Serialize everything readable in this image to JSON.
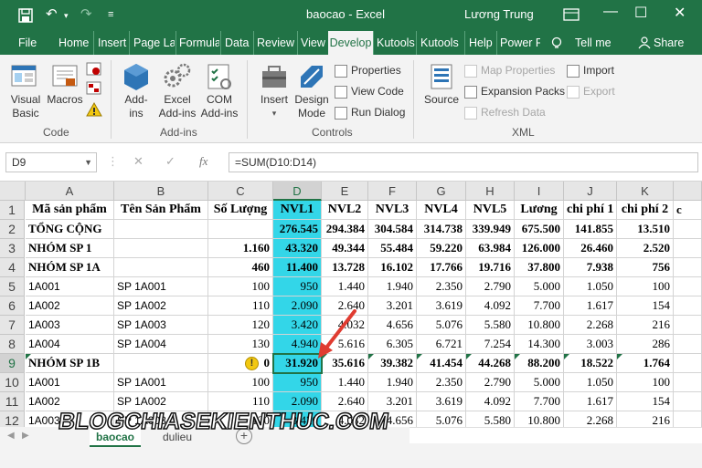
{
  "window": {
    "title": "baocao  -  Excel",
    "user": "Lương Trung",
    "minimize": "—",
    "restore": "☐",
    "close": "✕",
    "ribbon_display_icon": "ribbon-display-icon"
  },
  "quick_access": {
    "save_icon": "save-icon",
    "undo_icon": "undo-icon",
    "redo_icon": "redo-icon",
    "customize_icon": "customize-icon"
  },
  "tabs": [
    "File",
    "Home",
    "Insert",
    "Page La",
    "Formula",
    "Data",
    "Review",
    "View",
    "Develop",
    "Kutools",
    "Kutools",
    "Help",
    "Power P",
    "Tell me",
    "Share"
  ],
  "active_tab": "Develop",
  "ribbon": {
    "code": {
      "label": "Code",
      "visual_basic": [
        "Visual",
        "Basic"
      ],
      "macros": "Macros"
    },
    "addins": {
      "label": "Add-ins",
      "addins": [
        "Add-",
        "ins"
      ],
      "excel_addins": [
        "Excel",
        "Add-ins"
      ],
      "com_addins": [
        "COM",
        "Add-ins"
      ]
    },
    "controls": {
      "label": "Controls",
      "insert": "Insert",
      "design_mode": [
        "Design",
        "Mode"
      ],
      "properties": "Properties",
      "view_code": "View Code",
      "run_dialog": "Run Dialog"
    },
    "xml": {
      "label": "XML",
      "source": "Source",
      "map_properties": "Map Properties",
      "expansion_packs": "Expansion Packs",
      "refresh_data": "Refresh Data",
      "import": "Import",
      "export": "Export"
    }
  },
  "formula_bar": {
    "name_box": "D9",
    "cancel": "✕",
    "enter": "✓",
    "fx": "fx",
    "formula": "=SUM(D10:D14)"
  },
  "columns": [
    "A",
    "B",
    "C",
    "D",
    "E",
    "F",
    "G",
    "H",
    "I",
    "J",
    "K"
  ],
  "row_numbers": [
    "1",
    "2",
    "3",
    "4",
    "5",
    "6",
    "7",
    "8",
    "9",
    "10",
    "11",
    "12"
  ],
  "rows": [
    [
      "Mã sản phẩm",
      "Tên Sản Phẩm",
      "Số Lượng",
      "NVL1",
      "NVL2",
      "NVL3",
      "NVL4",
      "NVL5",
      "Lương",
      "chi phí 1",
      "chi phí 2"
    ],
    [
      "TỔNG CỘNG",
      "",
      "",
      "276.545",
      "294.384",
      "304.584",
      "314.738",
      "339.949",
      "675.500",
      "141.855",
      "13.510"
    ],
    [
      "NHÓM SP 1",
      "",
      "1.160",
      "43.320",
      "49.344",
      "55.484",
      "59.220",
      "63.984",
      "126.000",
      "26.460",
      "2.520"
    ],
    [
      "NHÓM SP 1A",
      "",
      "460",
      "11.400",
      "13.728",
      "16.102",
      "17.766",
      "19.716",
      "37.800",
      "7.938",
      "756"
    ],
    [
      "1A001",
      "SP 1A001",
      "100",
      "950",
      "1.440",
      "1.940",
      "2.350",
      "2.790",
      "5.000",
      "1.050",
      "100"
    ],
    [
      "1A002",
      "SP 1A002",
      "110",
      "2.090",
      "2.640",
      "3.201",
      "3.619",
      "4.092",
      "7.700",
      "1.617",
      "154"
    ],
    [
      "1A003",
      "SP 1A003",
      "120",
      "3.420",
      "4.032",
      "4.656",
      "5.076",
      "5.580",
      "10.800",
      "2.268",
      "216"
    ],
    [
      "1A004",
      "SP 1A004",
      "130",
      "4.940",
      "5.616",
      "6.305",
      "6.721",
      "7.254",
      "14.300",
      "3.003",
      "286"
    ],
    [
      "NHÓM SP 1B",
      "",
      "0",
      "31.920",
      "35.616",
      "39.382",
      "41.454",
      "44.268",
      "88.200",
      "18.522",
      "1.764"
    ],
    [
      "1A001",
      "SP 1A001",
      "100",
      "950",
      "1.440",
      "1.940",
      "2.350",
      "2.790",
      "5.000",
      "1.050",
      "100"
    ],
    [
      "1A002",
      "SP 1A002",
      "110",
      "2.090",
      "2.640",
      "3.201",
      "3.619",
      "4.092",
      "7.700",
      "1.617",
      "154"
    ],
    [
      "1A003",
      "SP 1A003",
      "120",
      "3.420",
      "4.032",
      "4.656",
      "5.076",
      "5.580",
      "10.800",
      "2.268",
      "216"
    ]
  ],
  "partial_col_L": "c",
  "selected_cell": "D9",
  "highlight_color": "#33d6e8",
  "sheets": [
    "baocao",
    "dulieu"
  ],
  "active_sheet": "baocao",
  "watermark": "BLOGCHIASEKIENTHUC.COM",
  "warning_icon": "warning-icon",
  "accent": "#217346"
}
